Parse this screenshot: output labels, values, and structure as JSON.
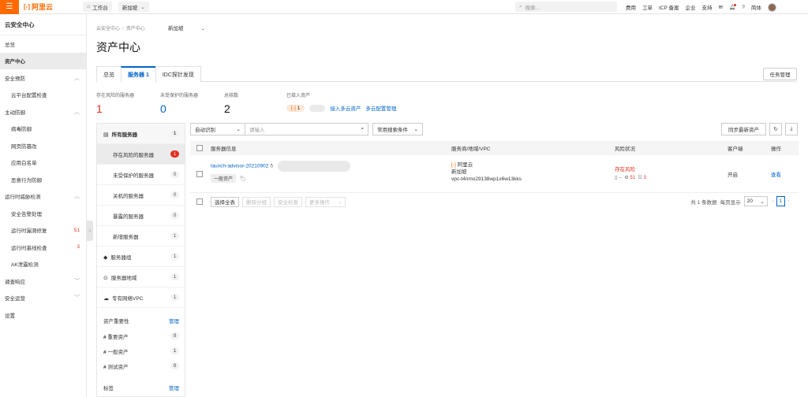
{
  "topbar": {
    "logo_text": "阿里云",
    "workbench": "工作台",
    "region": "新加坡",
    "search_placeholder": "搜索...",
    "links": [
      "费用",
      "工单",
      "ICP 备案",
      "企业",
      "支持"
    ],
    "lang": "简体"
  },
  "sidebar": {
    "title": "云安全中心",
    "items": [
      {
        "label": "总览",
        "type": "item"
      },
      {
        "label": "资产中心",
        "type": "active"
      },
      {
        "label": "安全预防",
        "type": "group"
      },
      {
        "label": "云平台配置检查",
        "type": "sub"
      },
      {
        "label": "主动防御",
        "type": "group"
      },
      {
        "label": "病毒防御",
        "type": "sub"
      },
      {
        "label": "网页防篡改",
        "type": "sub"
      },
      {
        "label": "应用白名单",
        "type": "sub"
      },
      {
        "label": "恶意行为防御",
        "type": "sub"
      },
      {
        "label": "运行时威胁检测",
        "type": "group"
      },
      {
        "label": "安全告警处理",
        "type": "sub"
      },
      {
        "label": "运行时漏洞修复",
        "type": "sub",
        "count": "51"
      },
      {
        "label": "运行时基线检查",
        "type": "sub",
        "count": "3"
      },
      {
        "label": "AK泄露检测",
        "type": "sub"
      },
      {
        "label": "调查响应",
        "type": "group"
      },
      {
        "label": "安全运营",
        "type": "group"
      },
      {
        "label": "设置",
        "type": "item"
      }
    ]
  },
  "header": {
    "breadcrumb": [
      "云安全中心",
      "资产中心"
    ],
    "region": "新加坡",
    "title": "资产中心"
  },
  "tabs": [
    "总览",
    "服务器 1",
    "IDC探针发现"
  ],
  "task_button": "任务管理",
  "stats": [
    {
      "label": "存在风险的服务器",
      "value": "1"
    },
    {
      "label": "未受保护的服务器",
      "value": "0"
    },
    {
      "label": "总核数",
      "value": "2"
    }
  ],
  "connected": {
    "label": "已接入资产",
    "aliyun_count": "1",
    "link1": "接入多云资产",
    "link2": "多云配置管理"
  },
  "tree": {
    "all": {
      "label": "所有服务器",
      "count": "1"
    },
    "subs": [
      {
        "label": "存在风险的服务器",
        "count": "1",
        "alert": true
      },
      {
        "label": "未受保护的服务器",
        "count": "0"
      },
      {
        "label": "关机的服务器",
        "count": "0"
      },
      {
        "label": "暴露的服务器",
        "count": "0"
      },
      {
        "label": "新增服务器",
        "count": "1"
      }
    ],
    "groups": [
      {
        "label": "服务器组",
        "count": "1"
      },
      {
        "label": "服务器地域",
        "count": "1"
      },
      {
        "label": "专有网络VPC",
        "count": "1"
      }
    ],
    "importance_title": "资产重要性",
    "manage": "管理",
    "importance": [
      {
        "label": "重要资产",
        "count": "0"
      },
      {
        "label": "一般资产",
        "count": "1"
      },
      {
        "label": "测试资产",
        "count": "0"
      }
    ],
    "tags_title": "标签"
  },
  "toolbar": {
    "mode": "自动识别",
    "input_placeholder": "请输入",
    "conditions": "常用搜索条件",
    "sync": "同步最新资产"
  },
  "table": {
    "columns": [
      "服务器信息",
      "服务商/地域/VPC",
      "风险状况",
      "客户端",
      "操作"
    ],
    "rows": [
      {
        "name": "launch-advisor-20210902",
        "group_tag": "一般资产",
        "provider": "阿里云",
        "region": "新加坡",
        "vpc": "vpc-t4nmo29138wp1x6w13kks",
        "risk": "存在风险",
        "vuln": "51",
        "baseline": "3",
        "client": "开启",
        "action": "查看"
      }
    ]
  },
  "footer": {
    "buttons": [
      "选择全表",
      "删除分组",
      "安全检查",
      "更多操作"
    ],
    "total": "共 1 条数据",
    "per_page_label": "每页显示",
    "per_page": "20",
    "page": "1"
  }
}
